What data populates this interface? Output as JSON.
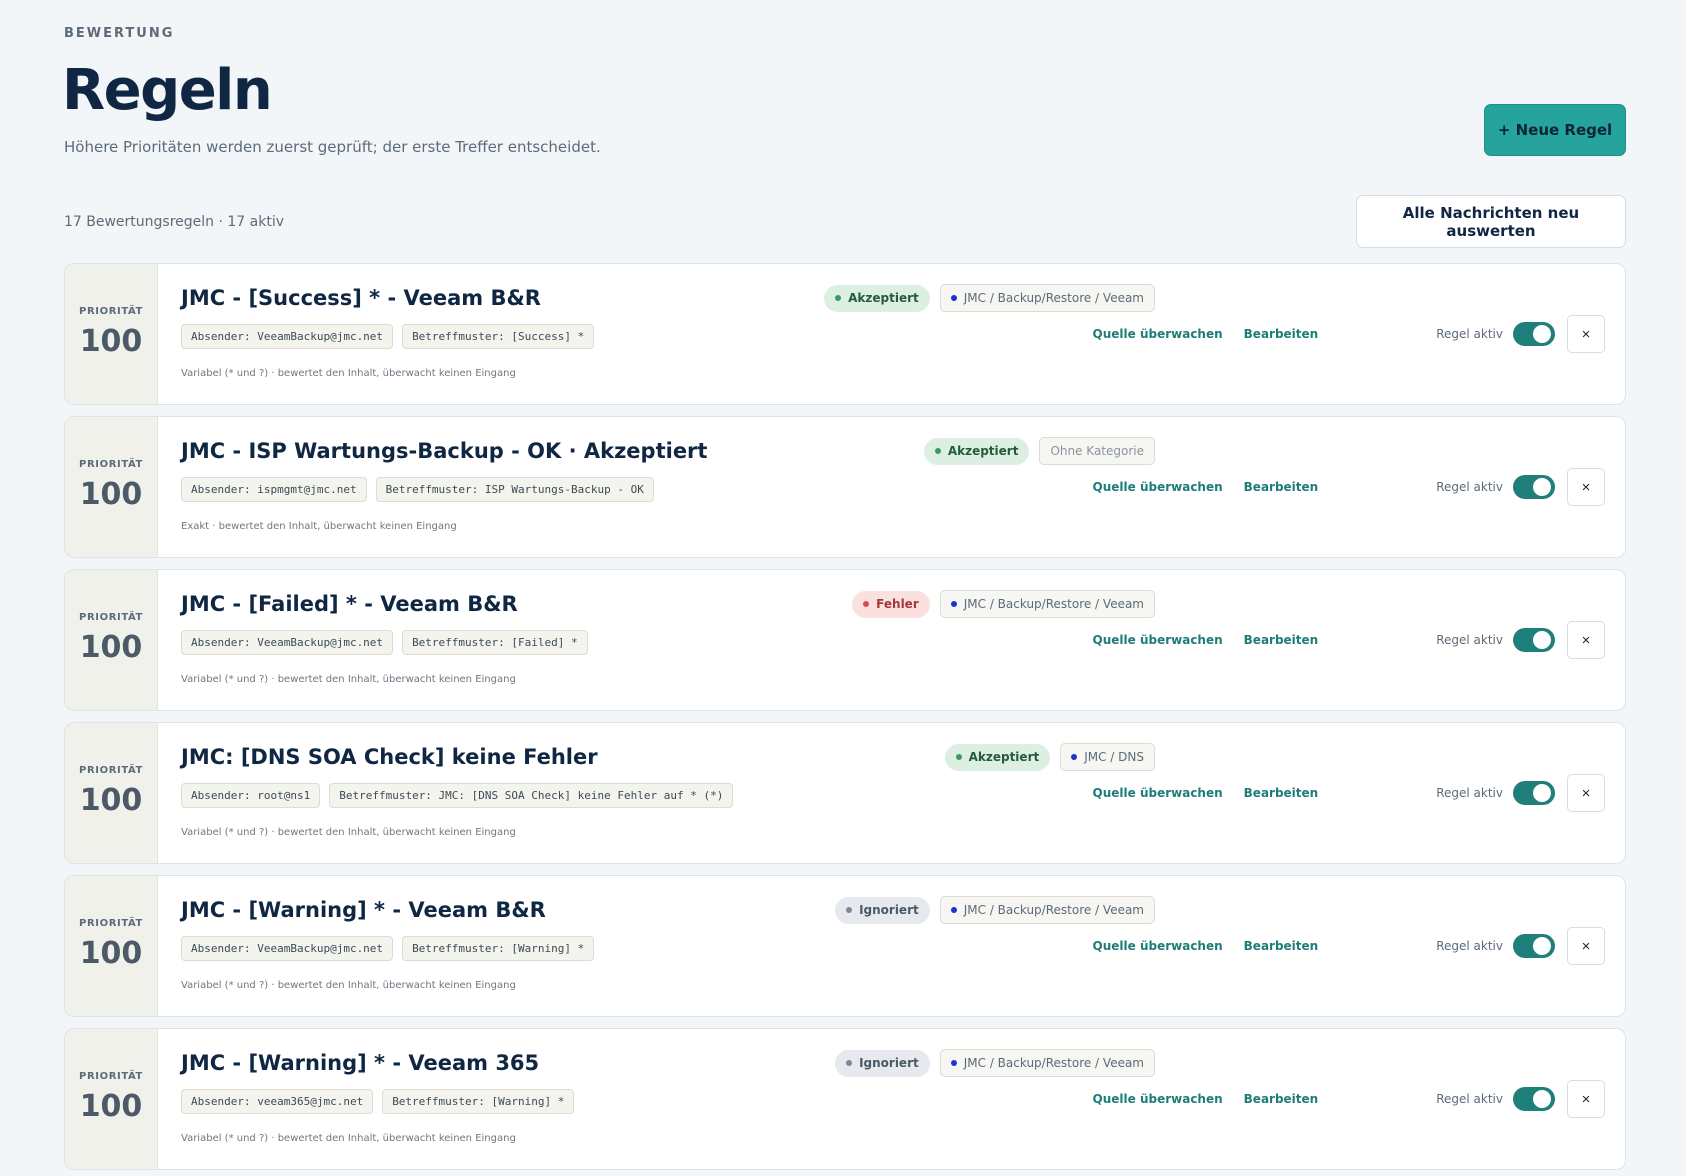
{
  "header": {
    "eyebrow": "BEWERTUNG",
    "title": "Regeln",
    "subtitle": "Höhere Prioritäten werden zuerst geprüft; der erste Treffer entscheidet.",
    "new_rule_label": "+ Neue Regel"
  },
  "toolbar": {
    "summary": "17 Bewertungsregeln · 17 aktiv",
    "reevaluate_label": "Alle Nachrichten neu auswerten"
  },
  "labels": {
    "priority": "PRIORITÄT",
    "watch_source": "Quelle überwachen",
    "edit": "Bearbeiten",
    "rule_active": "Regel aktiv",
    "delete_glyph": "×"
  },
  "colors": {
    "accent": "#26a39c",
    "toggle_on": "#1f7f7a",
    "link": "#1e7d78",
    "accepted_bg": "#dcefe2",
    "error_bg": "#fbe0e0",
    "ignored_bg": "#e6e9ed",
    "category_dot": "#1a33d6"
  },
  "rules": [
    {
      "priority": "100",
      "name": "JMC - [Success] * - Veeam B&R",
      "sender": "Absender: VeeamBackup@jmc.net",
      "subject": "Betreffmuster: [Success] *",
      "note": "Variabel (* und ?) · bewertet den Inhalt, überwacht keinen Eingang",
      "status": "Akzeptiert",
      "status_kind": "accepted",
      "category": "JMC / Backup/Restore / Veeam",
      "has_category": true,
      "active": true
    },
    {
      "priority": "100",
      "name": "JMC - ISP Wartungs-Backup - OK · Akzeptiert",
      "sender": "Absender: ispmgmt@jmc.net",
      "subject": "Betreffmuster: ISP Wartungs-Backup - OK",
      "note": "Exakt · bewertet den Inhalt, überwacht keinen Eingang",
      "status": "Akzeptiert",
      "status_kind": "accepted",
      "category": "Ohne Kategorie",
      "has_category": false,
      "active": true
    },
    {
      "priority": "100",
      "name": "JMC - [Failed] * - Veeam B&R",
      "sender": "Absender: VeeamBackup@jmc.net",
      "subject": "Betreffmuster: [Failed] *",
      "note": "Variabel (* und ?) · bewertet den Inhalt, überwacht keinen Eingang",
      "status": "Fehler",
      "status_kind": "error",
      "category": "JMC / Backup/Restore / Veeam",
      "has_category": true,
      "active": true
    },
    {
      "priority": "100",
      "name": "JMC: [DNS SOA Check] keine Fehler",
      "sender": "Absender: root@ns1",
      "subject": "Betreffmuster: JMC: [DNS SOA Check] keine Fehler auf * (*)",
      "note": "Variabel (* und ?) · bewertet den Inhalt, überwacht keinen Eingang",
      "status": "Akzeptiert",
      "status_kind": "accepted",
      "category": "JMC / DNS",
      "has_category": true,
      "active": true
    },
    {
      "priority": "100",
      "name": "JMC - [Warning] * - Veeam B&R",
      "sender": "Absender: VeeamBackup@jmc.net",
      "subject": "Betreffmuster: [Warning] *",
      "note": "Variabel (* und ?) · bewertet den Inhalt, überwacht keinen Eingang",
      "status": "Ignoriert",
      "status_kind": "ignored",
      "category": "JMC / Backup/Restore / Veeam",
      "has_category": true,
      "active": true
    },
    {
      "priority": "100",
      "name": "JMC - [Warning] * - Veeam 365",
      "sender": "Absender: veeam365@jmc.net",
      "subject": "Betreffmuster: [Warning] *",
      "note": "Variabel (* und ?) · bewertet den Inhalt, überwacht keinen Eingang",
      "status": "Ignoriert",
      "status_kind": "ignored",
      "category": "JMC / Backup/Restore / Veeam",
      "has_category": true,
      "active": true
    }
  ]
}
